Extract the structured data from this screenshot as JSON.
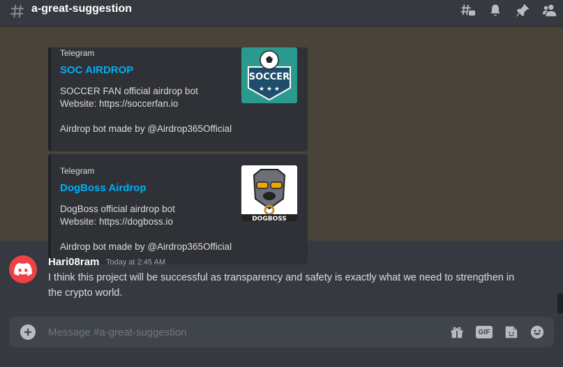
{
  "channel": {
    "name": "a-great-suggestion"
  },
  "header_icons": [
    "threads-icon",
    "bell-icon",
    "pin-icon",
    "members-icon"
  ],
  "embeds": [
    {
      "provider": "Telegram",
      "title": "SOC AIRDROP",
      "desc_line1": "SOCCER FAN official airdrop bot",
      "desc_line2": "Website: https://soccerfan.io",
      "desc_line3": "Airdrop bot made by @Airdrop365Official",
      "thumb_text": "SOCCER"
    },
    {
      "provider": "Telegram",
      "title": "DogBoss Airdrop",
      "desc_line1": "DogBoss official airdrop bot",
      "desc_line2": "Website: https://dogboss.io",
      "desc_line3": "Airdrop bot made by @Airdrop365Official",
      "thumb_text": "DOGBOSS"
    }
  ],
  "message": {
    "username": "Hari08ram",
    "timestamp": "Today at 2:45 AM",
    "text": "I think this project will be successful as transparency and safety is exactly what we need to strengthen in the crypto world."
  },
  "composer": {
    "placeholder": "Message #a-great-suggestion",
    "gif_label": "GIF"
  },
  "colors": {
    "background": "#36393f",
    "highlight": "#49443b",
    "embed_bg": "#2f3136",
    "link": "#00aff4",
    "avatar": "#ed4245"
  }
}
